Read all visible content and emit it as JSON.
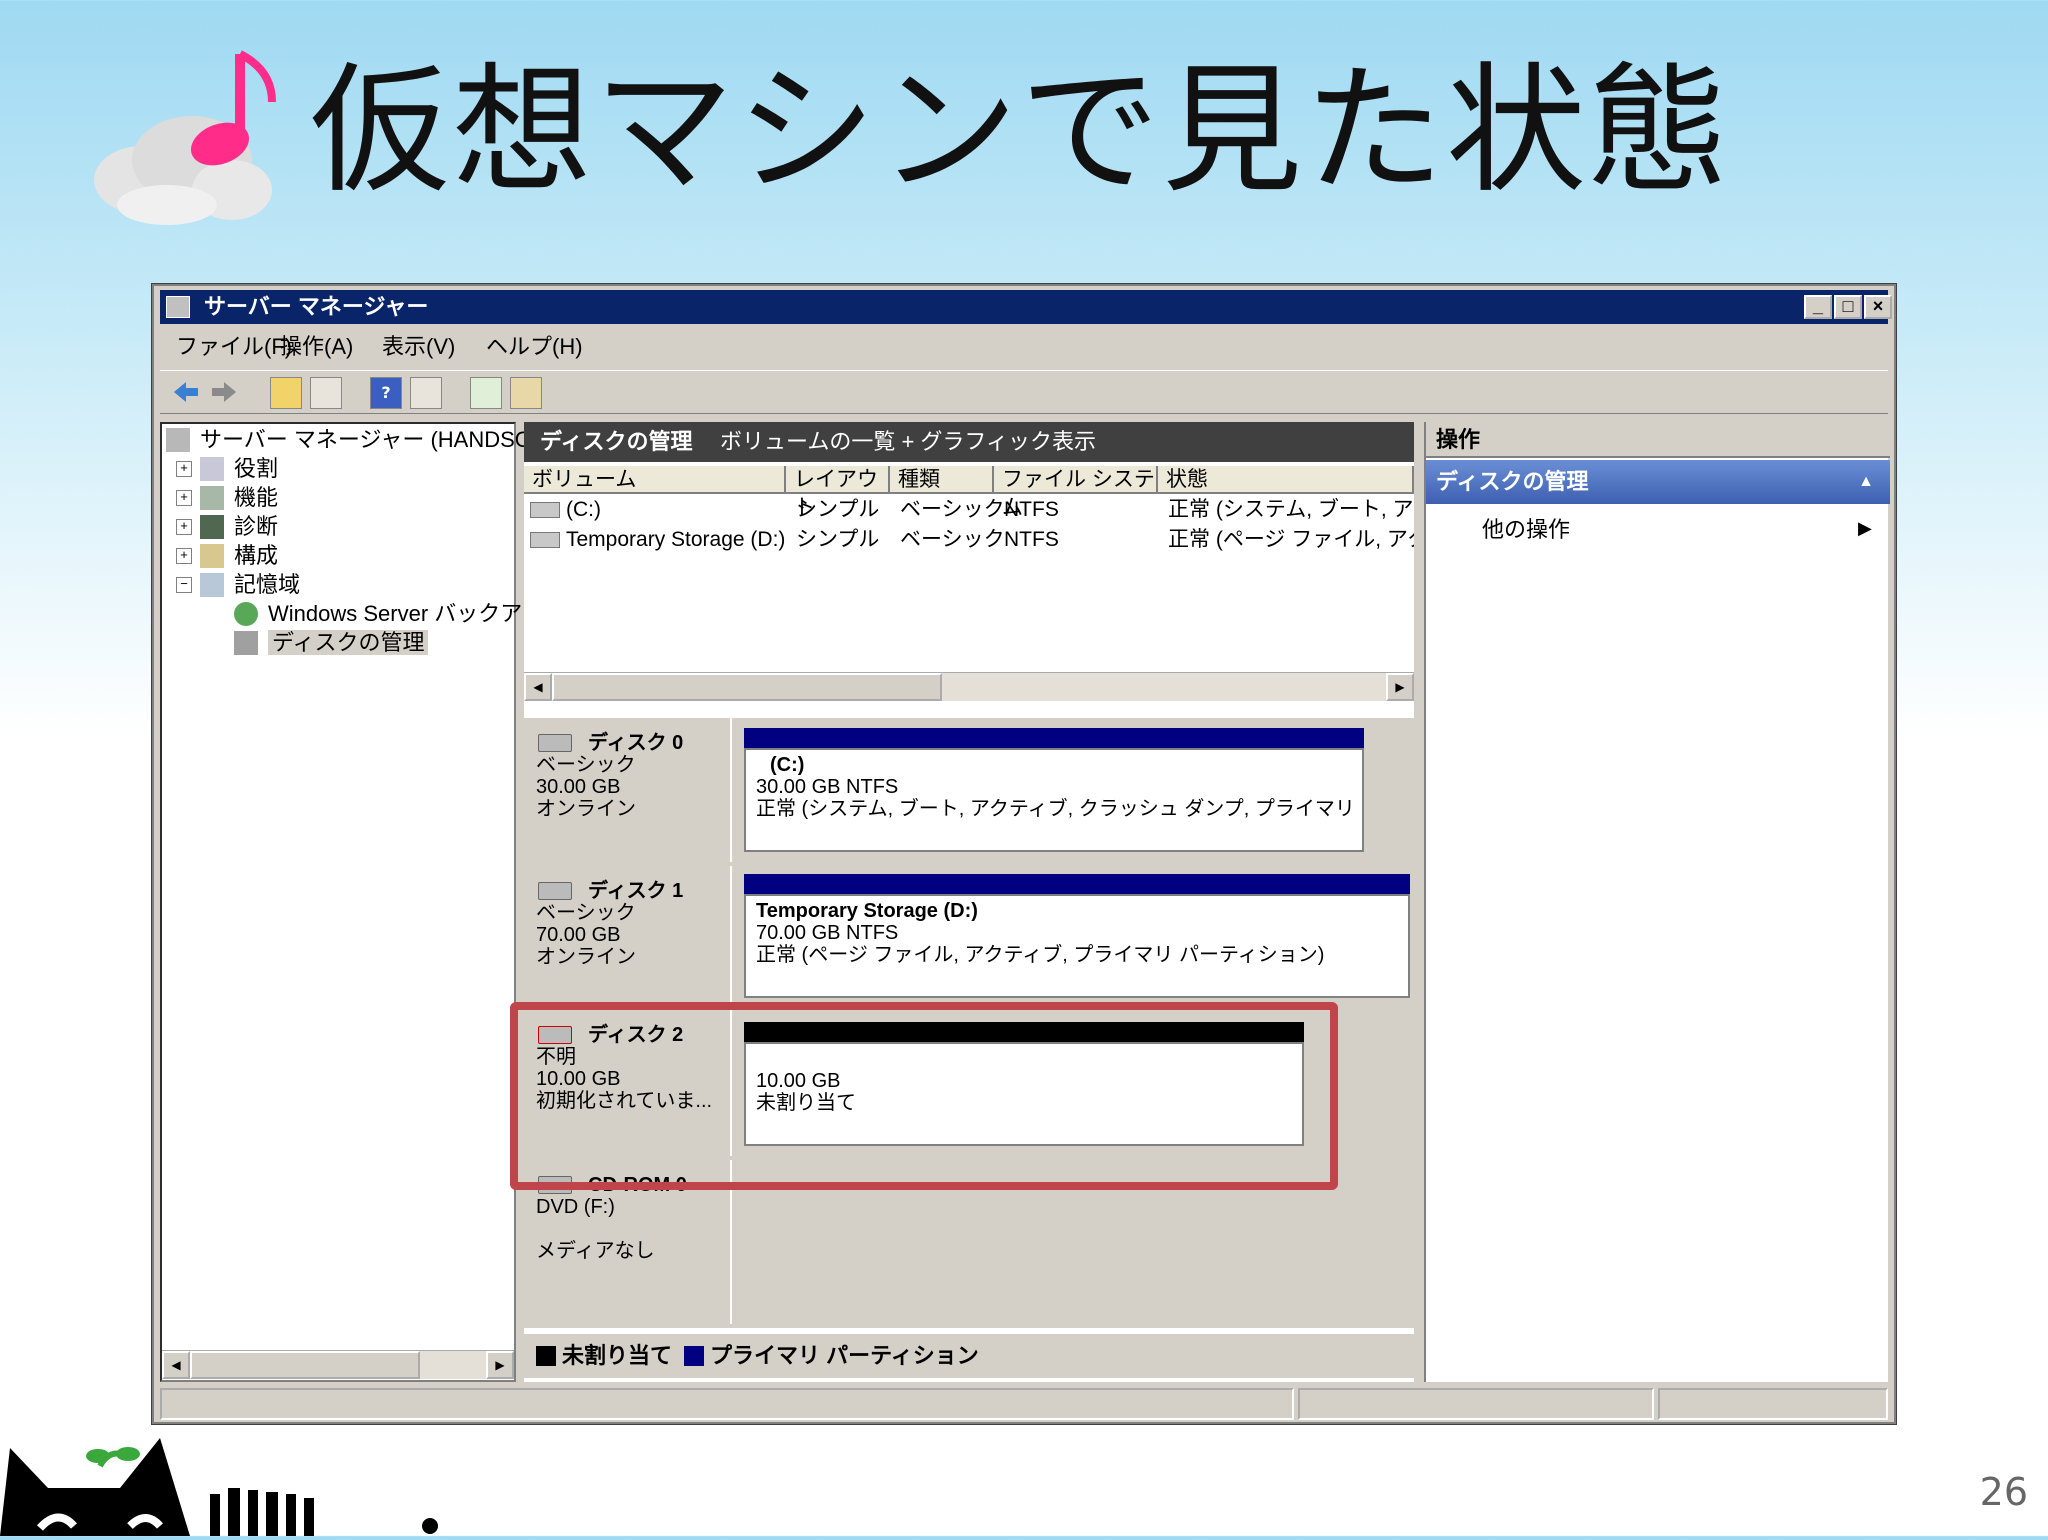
{
  "slide": {
    "title": "仮想マシンで見た状態",
    "page_number": "26"
  },
  "window": {
    "title": "サーバー マネージャー",
    "controls": [
      "_",
      "□",
      "×"
    ]
  },
  "menu": [
    "ファイル(F)",
    "操作(A)",
    "表示(V)",
    "ヘルプ(H)"
  ],
  "toolbar_icons": [
    "back-icon",
    "forward-icon",
    "up-folder-icon",
    "console-tree-icon",
    "help-icon",
    "action-pane-icon",
    "refresh-icon",
    "properties-icon"
  ],
  "tree": {
    "root": "サーバー マネージャー (HANDSONY",
    "items": [
      {
        "label": "役割",
        "expander": "+"
      },
      {
        "label": "機能",
        "expander": "+"
      },
      {
        "label": "診断",
        "expander": "+"
      },
      {
        "label": "構成",
        "expander": "+"
      },
      {
        "label": "記憶域",
        "expander": "−"
      }
    ],
    "children": [
      "Windows Server バックアップ",
      "ディスクの管理"
    ]
  },
  "center": {
    "header_title": "ディスクの管理",
    "header_subtitle": "ボリュームの一覧 + グラフィック表示",
    "columns": [
      "ボリューム",
      "レイアウト",
      "種類",
      "ファイル システム",
      "状態"
    ],
    "rows": [
      {
        "volume": "(C:)",
        "layout": "シンプル",
        "type": "ベーシック",
        "fs": "NTFS",
        "status": "正常 (システム, ブート, アクテ"
      },
      {
        "volume": "Temporary Storage (D:)",
        "layout": "シンプル",
        "type": "ベーシック",
        "fs": "NTFS",
        "status": "正常 (ページ ファイル, アクテ"
      }
    ]
  },
  "disks": [
    {
      "name": "ディスク 0",
      "type": "ベーシック",
      "size": "30.00 GB",
      "state": "オンライン",
      "vol_title": "(C:)",
      "vol_size": "30.00 GB NTFS",
      "vol_status": "正常 (システム, ブート, アクティブ, クラッシュ ダンプ, プライマリ パーティ"
    },
    {
      "name": "ディスク 1",
      "type": "ベーシック",
      "size": "70.00 GB",
      "state": "オンライン",
      "vol_title": "Temporary Storage  (D:)",
      "vol_size": "70.00 GB NTFS",
      "vol_status": "正常 (ページ ファイル, アクティブ, プライマリ パーティション)"
    },
    {
      "name": "ディスク 2",
      "type": "不明",
      "size": "10.00 GB",
      "state": "初期化されていま...",
      "vol_size": "10.00 GB",
      "vol_status": "未割り当て"
    },
    {
      "name": "CD-ROM 0",
      "type": "DVD (F:)",
      "state": "メディアなし"
    }
  ],
  "legend": {
    "unallocated": "未割り当て",
    "primary": "プライマリ パーティション",
    "unallocated_color": "#000000",
    "primary_color": "#000080"
  },
  "actions": {
    "header": "操作",
    "section": "ディスクの管理",
    "item": "他の操作"
  },
  "colors": {
    "titlebar": "#0a246a",
    "highlight": "#c0454a"
  }
}
